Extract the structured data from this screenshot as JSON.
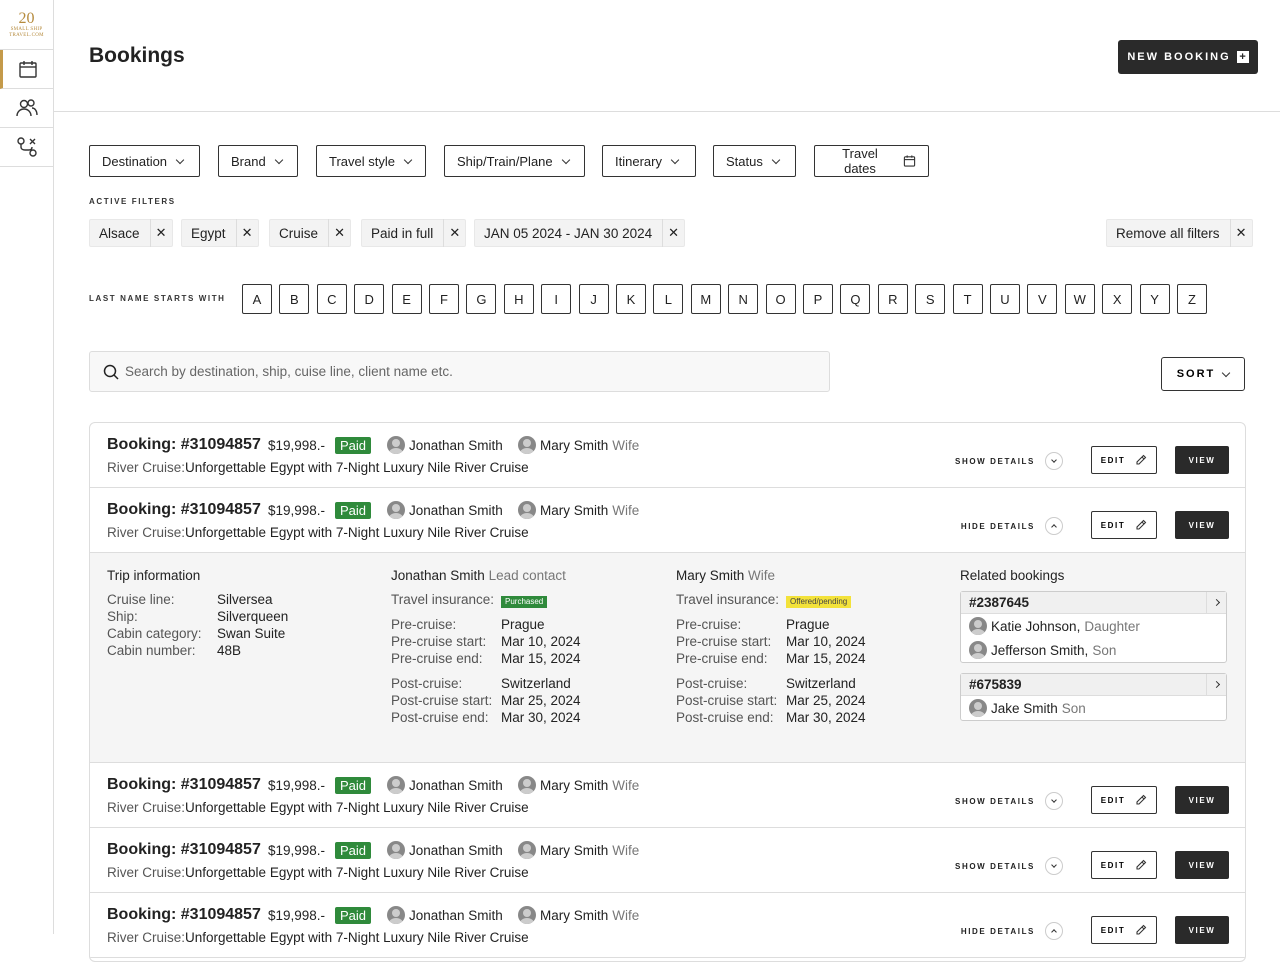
{
  "sidebar": {
    "logo_number": "20",
    "logo_text": "SMALL SHIP TRAVEL.COM",
    "items": [
      "calendar-icon",
      "users-icon",
      "route-icon"
    ]
  },
  "header": {
    "title": "Bookings",
    "new_booking_label": "NEW BOOKING"
  },
  "filters": [
    {
      "label": "Destination",
      "icon": "chevron"
    },
    {
      "label": "Brand",
      "icon": "chevron"
    },
    {
      "label": "Travel style",
      "icon": "chevron"
    },
    {
      "label": "Ship/Train/Plane",
      "icon": "chevron"
    },
    {
      "label": "Itinerary",
      "icon": "chevron"
    },
    {
      "label": "Status",
      "icon": "chevron"
    },
    {
      "label": "Travel dates",
      "icon": "calendar"
    }
  ],
  "active_filters_label": "ACTIVE FILTERS",
  "active_filters": [
    "Alsace",
    "Egypt",
    "Cruise",
    "Paid in full",
    "JAN 05 2024 - JAN 30 2024"
  ],
  "remove_all_label": "Remove all filters",
  "lastname_label": "LAST NAME STARTS WITH",
  "letters": [
    "A",
    "B",
    "C",
    "D",
    "E",
    "F",
    "G",
    "H",
    "I",
    "J",
    "K",
    "L",
    "M",
    "N",
    "O",
    "P",
    "Q",
    "R",
    "S",
    "T",
    "U",
    "V",
    "W",
    "X",
    "Y",
    "Z"
  ],
  "search": {
    "placeholder": "Search by destination, ship, cuise line, client name etc."
  },
  "sort_label": "SORT",
  "bookings": [
    {
      "title": "Booking: #31094857",
      "price": "$19,998.-",
      "status": "Paid",
      "p1": "Jonathan Smith",
      "p2": "Mary Smith",
      "p2_rel": "Wife",
      "type": "River Cruise:",
      "trip": "Unforgettable Egypt with 7-Night Luxury Nile River Cruise",
      "details": "SHOW DETAILS"
    },
    {
      "title": "Booking: #31094857",
      "price": "$19,998.-",
      "status": "Paid",
      "p1": "Jonathan Smith",
      "p2": "Mary Smith",
      "p2_rel": "Wife",
      "type": "River Cruise:",
      "trip": "Unforgettable Egypt with 7-Night Luxury Nile River Cruise",
      "details": "HIDE DETAILS"
    },
    {
      "title": "Booking: #31094857",
      "price": "$19,998.-",
      "status": "Paid",
      "p1": "Jonathan Smith",
      "p2": "Mary Smith",
      "p2_rel": "Wife",
      "type": "River Cruise:",
      "trip": "Unforgettable Egypt with 7-Night Luxury Nile River Cruise",
      "details": "SHOW DETAILS"
    },
    {
      "title": "Booking: #31094857",
      "price": "$19,998.-",
      "status": "Paid",
      "p1": "Jonathan Smith",
      "p2": "Mary Smith",
      "p2_rel": "Wife",
      "type": "River Cruise:",
      "trip": "Unforgettable Egypt with 7-Night Luxury Nile River Cruise",
      "details": "SHOW DETAILS"
    },
    {
      "title": "Booking: #31094857",
      "price": "$19,998.-",
      "status": "Paid",
      "p1": "Jonathan Smith",
      "p2": "Mary Smith",
      "p2_rel": "Wife",
      "type": "River Cruise:",
      "trip": "Unforgettable Egypt with 7-Night Luxury Nile River Cruise",
      "details": "HIDE DETAILS"
    }
  ],
  "edit_label": "EDIT",
  "view_label": "VIEW",
  "expanded": {
    "trip_title": "Trip information",
    "trip": [
      [
        "Cruise line:",
        "Silversea"
      ],
      [
        "Ship:",
        "Silverqueen"
      ],
      [
        "Cabin category:",
        "Swan Suite"
      ],
      [
        "Cabin number:",
        "48B"
      ]
    ],
    "lead": {
      "name": "Jonathan Smith",
      "role": "Lead contact",
      "insurance_label": "Travel insurance:",
      "insurance": "Purchased",
      "pre": [
        [
          "Pre-cruise:",
          "Prague"
        ],
        [
          "Pre-cruise start:",
          "Mar 10, 2024"
        ],
        [
          "Pre-cruise end:",
          "Mar 15, 2024"
        ]
      ],
      "post": [
        [
          "Post-cruise:",
          "Switzerland"
        ],
        [
          "Post-cruise start:",
          "Mar 25, 2024"
        ],
        [
          "Post-cruise end:",
          "Mar 30, 2024"
        ]
      ]
    },
    "second": {
      "name": "Mary Smith",
      "role": "Wife",
      "insurance_label": "Travel insurance:",
      "insurance": "Offered/pending",
      "pre": [
        [
          "Pre-cruise:",
          "Prague"
        ],
        [
          "Pre-cruise start:",
          "Mar 10, 2024"
        ],
        [
          "Pre-cruise end:",
          "Mar 15, 2024"
        ]
      ],
      "post": [
        [
          "Post-cruise:",
          "Switzerland"
        ],
        [
          "Post-cruise start:",
          "Mar 25, 2024"
        ],
        [
          "Post-cruise end:",
          "Mar 30, 2024"
        ]
      ]
    },
    "related_title": "Related bookings",
    "related": [
      {
        "id": "#2387645",
        "people": [
          {
            "name": "Katie Johnson",
            "sep": ",",
            "rel": "Daughter"
          },
          {
            "name": "Jefferson Smith",
            "sep": ",",
            "rel": "Son"
          }
        ]
      },
      {
        "id": "#675839",
        "people": [
          {
            "name": "Jake Smith",
            "sep": "",
            "rel": "Son"
          }
        ]
      }
    ]
  }
}
